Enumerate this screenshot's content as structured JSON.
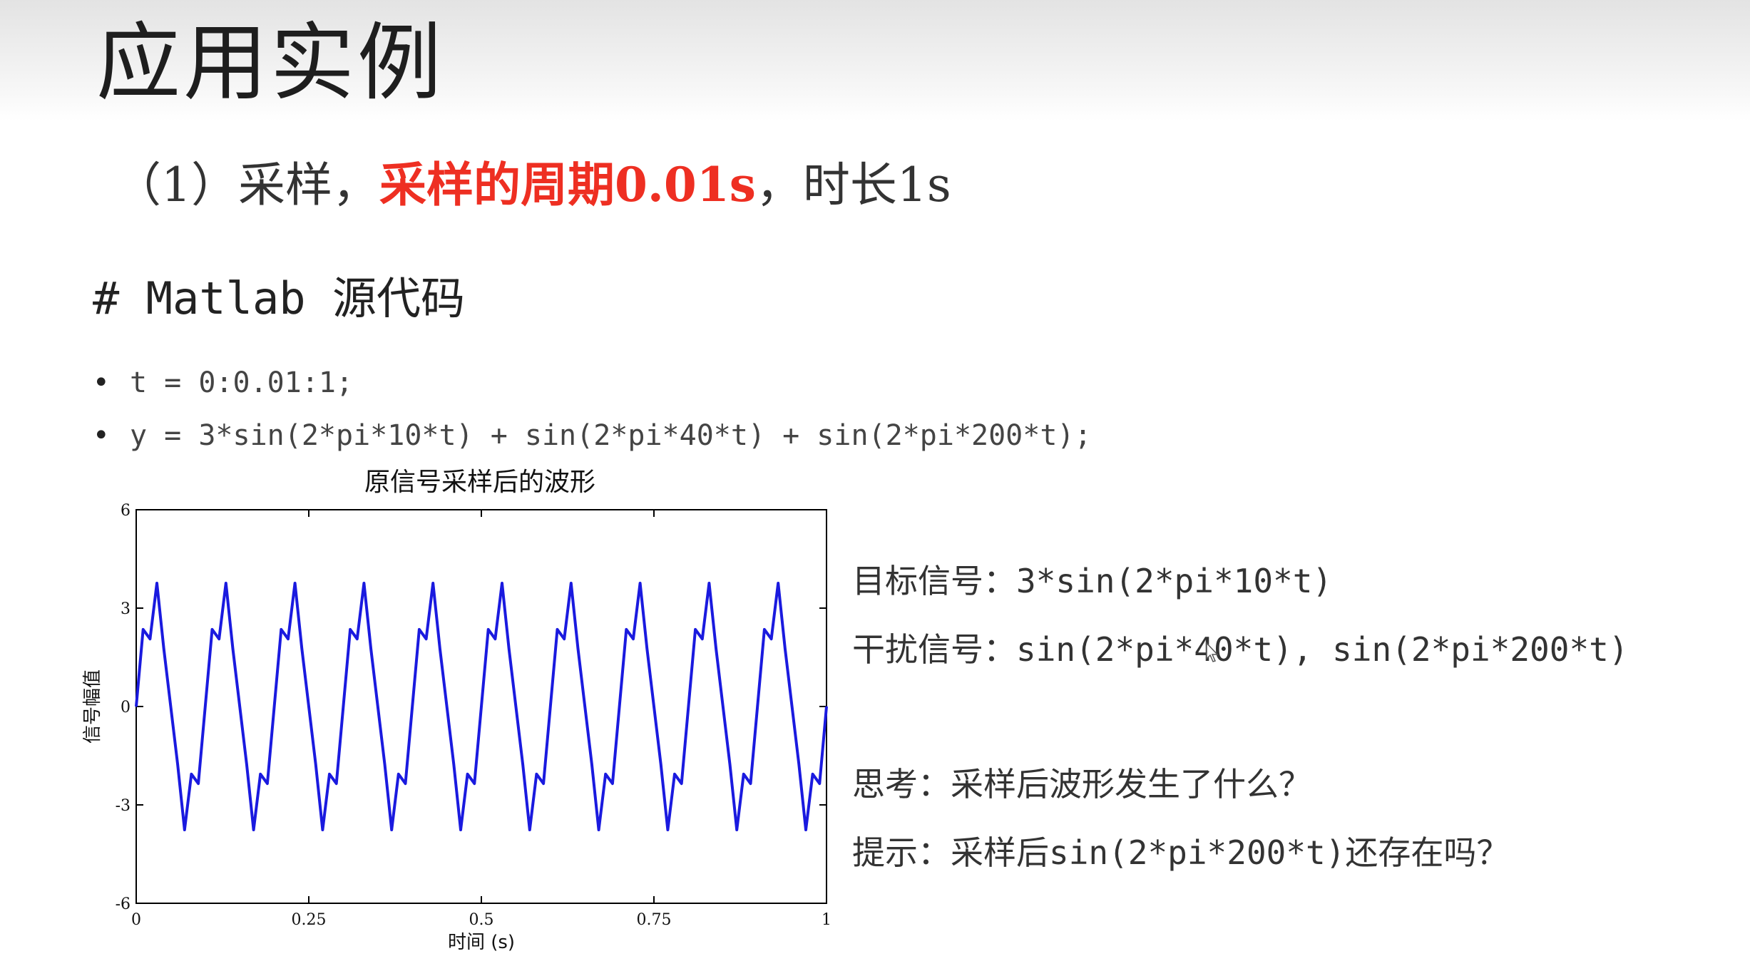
{
  "slide": {
    "title": "应用实例",
    "subtitle_prefix": "（1）采样，",
    "subtitle_highlight": "采样的周期0.01s",
    "subtitle_suffix": "，时长1s",
    "accent_color": "#ee2f22",
    "code_heading": "# Matlab 源代码",
    "code_lines": [
      "t = 0:0.01:1;",
      "y = 3*sin(2*pi*10*t) + sin(2*pi*40*t) + sin(2*pi*200*t);"
    ],
    "notes": [
      "目标信号：3*sin(2*pi*10*t)",
      "干扰信号：sin(2*pi*40*t), sin(2*pi*200*t)",
      "思考：采样后波形发生了什么？",
      "提示：采样后sin(2*pi*200*t)还存在吗？"
    ]
  },
  "chart_data": {
    "type": "line",
    "title": "原信号采样后的波形",
    "xlabel": "时间 (s)",
    "ylabel": "信号幅值",
    "xlim": [
      0,
      1
    ],
    "ylim": [
      -6,
      6
    ],
    "x_ticks": [
      0,
      0.25,
      0.5,
      0.75,
      1
    ],
    "x_tick_labels": [
      "0",
      "0.25",
      "0.5",
      "0.75",
      "1"
    ],
    "y_ticks": [
      6,
      3,
      0,
      -3,
      -6
    ],
    "y_tick_labels": [
      "6",
      "3",
      "0",
      "-3",
      "-6"
    ],
    "grid": false,
    "line_color": "#1a1adf",
    "series": [
      {
        "x": [
          0,
          0.01,
          0.02,
          0.03,
          0.04,
          0.05,
          0.06,
          0.07,
          0.08,
          0.09,
          0.1,
          0.11,
          0.12,
          0.13,
          0.14,
          0.15,
          0.16,
          0.17,
          0.18,
          0.19,
          0.2,
          0.21,
          0.22,
          0.23,
          0.24,
          0.25,
          0.26,
          0.27,
          0.28,
          0.29,
          0.3,
          0.31,
          0.32,
          0.33,
          0.34,
          0.35,
          0.36,
          0.37,
          0.38,
          0.39,
          0.4,
          0.41,
          0.42,
          0.43,
          0.44,
          0.45,
          0.46,
          0.47,
          0.48,
          0.49,
          0.5,
          0.51,
          0.52,
          0.53,
          0.54,
          0.55,
          0.56,
          0.57,
          0.58,
          0.59,
          0.6,
          0.61,
          0.62,
          0.63,
          0.64,
          0.65,
          0.66,
          0.67,
          0.68,
          0.69,
          0.7,
          0.71,
          0.72,
          0.73,
          0.74,
          0.75,
          0.76,
          0.77,
          0.78,
          0.79,
          0.8,
          0.81,
          0.82,
          0.83,
          0.84,
          0.85,
          0.86,
          0.87,
          0.88,
          0.89,
          0.9,
          0.91,
          0.92,
          0.93,
          0.94,
          0.95,
          0.96,
          0.97,
          0.98,
          0.99,
          1
        ],
        "y": [
          0,
          2.35,
          2.06,
          3.76,
          1.76,
          0,
          -1.76,
          -3.76,
          -2.06,
          -2.35,
          0,
          2.35,
          2.06,
          3.76,
          1.76,
          0,
          -1.76,
          -3.76,
          -2.06,
          -2.35,
          0,
          2.35,
          2.06,
          3.76,
          1.76,
          0,
          -1.76,
          -3.76,
          -2.06,
          -2.35,
          0,
          2.35,
          2.06,
          3.76,
          1.76,
          0,
          -1.76,
          -3.76,
          -2.06,
          -2.35,
          0,
          2.35,
          2.06,
          3.76,
          1.76,
          0,
          -1.76,
          -3.76,
          -2.06,
          -2.35,
          0,
          2.35,
          2.06,
          3.76,
          1.76,
          0,
          -1.76,
          -3.76,
          -2.06,
          -2.35,
          0,
          2.35,
          2.06,
          3.76,
          1.76,
          0,
          -1.76,
          -3.76,
          -2.06,
          -2.35,
          0,
          2.35,
          2.06,
          3.76,
          1.76,
          0,
          -1.76,
          -3.76,
          -2.06,
          -2.35,
          0,
          2.35,
          2.06,
          3.76,
          1.76,
          0,
          -1.76,
          -3.76,
          -2.06,
          -2.35,
          0,
          2.35,
          2.06,
          3.76,
          1.76,
          0,
          -1.76,
          -3.76,
          -2.06,
          -2.35,
          0
        ]
      }
    ]
  }
}
